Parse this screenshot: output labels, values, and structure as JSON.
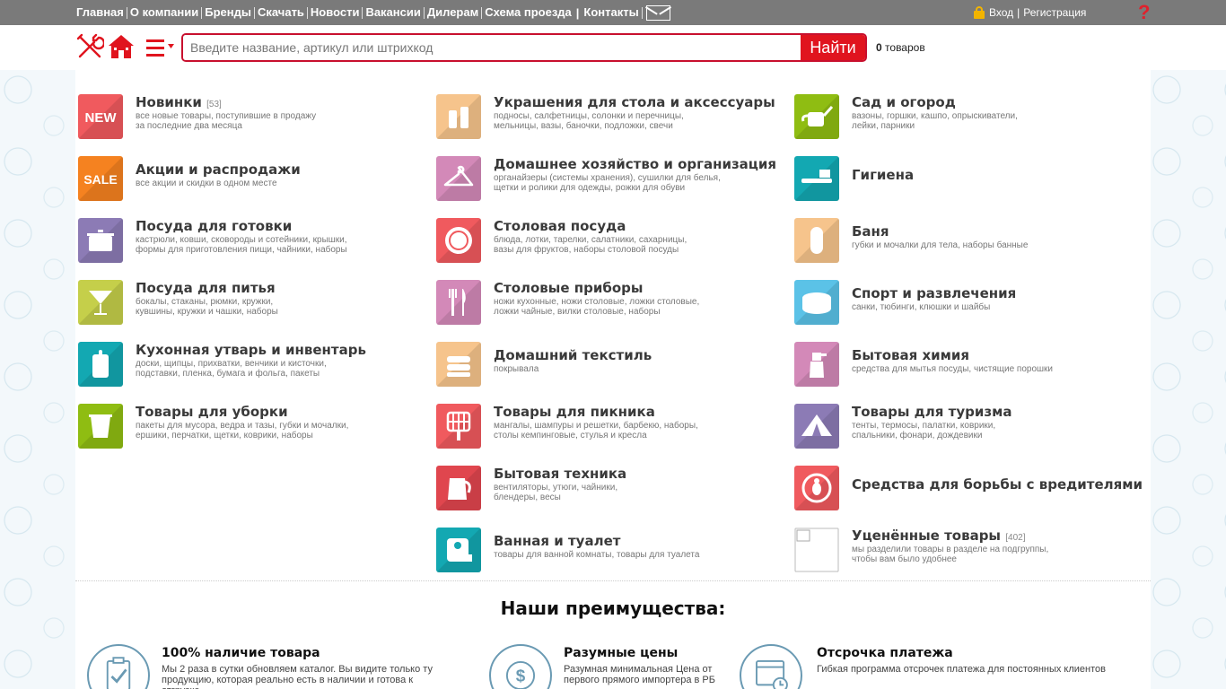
{
  "topnav": {
    "items": [
      "Главная",
      "О компании",
      "Бренды",
      "Скачать",
      "Новости",
      "Вакансии",
      "Дилерам",
      "Схема проезда",
      "Контакты"
    ],
    "mail_icon": "mail-icon"
  },
  "auth": {
    "login": "Вход",
    "separator": "|",
    "register": "Регистрация"
  },
  "help": {
    "label": "?"
  },
  "search": {
    "placeholder": "Введите название, артикул или штрихкод",
    "value": "",
    "button": "Найти"
  },
  "cart": {
    "count": "0",
    "label": "товаров"
  },
  "colors": {
    "accent": "#e0141e",
    "topbar": "#7a7a7a"
  },
  "categories": [
    {
      "title": "Новинки",
      "count": "[53]",
      "sub1": "все новые товары, поступившие в продажу",
      "sub2": "за последние два месяца",
      "icon": "new-badge-icon",
      "color": "#f05a5e"
    },
    {
      "title": "Акции и распродажи",
      "count": "",
      "sub1": "все акции и скидки в одном месте",
      "sub2": "",
      "icon": "sale-badge-icon",
      "color": "#f58220"
    },
    {
      "title": "Посуда для готовки",
      "count": "",
      "sub1": "кастрюли, ковши, сковороды и сотейники, крышки,",
      "sub2": "формы для приготовления пищи, чайники, наборы",
      "icon": "pot-icon",
      "color": "#8c7bb5"
    },
    {
      "title": "Посуда для питья",
      "count": "",
      "sub1": "бокалы, стаканы, рюмки, кружки,",
      "sub2": "кувшины, кружки и чашки, наборы",
      "icon": "cocktail-glass-icon",
      "color": "#c5cf4a"
    },
    {
      "title": "Кухонная утварь и инвентарь",
      "count": "",
      "sub1": "доски, щипцы, прихватки, венчики и кисточки,",
      "sub2": "подставки, пленка, бумага и фольга, пакеты",
      "icon": "cutting-board-icon",
      "color": "#13a8b2"
    },
    {
      "title": "Товары для уборки",
      "count": "",
      "sub1": "пакеты для мусора, ведра и тазы, губки и мочалки,",
      "sub2": "ершики, перчатки, щетки, коврики, наборы",
      "icon": "bucket-icon",
      "color": "#8fbd12"
    },
    {
      "title": "Украшения для стола и аксессуары",
      "count": "",
      "sub1": "подносы, салфетницы, солонки и перечницы,",
      "sub2": "мельницы, вазы, баночки, подложки, свечи",
      "icon": "salt-pepper-icon",
      "color": "#f6c48c"
    },
    {
      "title": "Домашнее хозяйство и организация",
      "count": "",
      "sub1": "органайзеры (системы хранения), сушилки для белья,",
      "sub2": "щетки и ролики для одежды, рожки для обуви",
      "icon": "hanger-icon",
      "color": "#d389b8"
    },
    {
      "title": "Столовая посуда",
      "count": "",
      "sub1": "блюда, лотки, тарелки, салатники, сахарницы,",
      "sub2": "вазы для фруктов, наборы столовой посуды",
      "icon": "plate-icon",
      "color": "#f05a5e"
    },
    {
      "title": "Столовые приборы",
      "count": "",
      "sub1": "ножи кухонные, ножи столовые, ложки столовые,",
      "sub2": "ложки чайные, вилки столовые, наборы",
      "icon": "cutlery-icon",
      "color": "#d389b8"
    },
    {
      "title": "Домашний текстиль",
      "count": "",
      "sub1": "покрывала",
      "sub2": "",
      "icon": "towels-icon",
      "color": "#f6c48c"
    },
    {
      "title": "Товары для пикника",
      "count": "",
      "sub1": "мангалы, шампуры и решетки, барбекю, наборы,",
      "sub2": "столы кемпинговые, стулья и кресла",
      "icon": "grill-grate-icon",
      "color": "#f05a5e"
    },
    {
      "title": "Бытовая техника",
      "count": "",
      "sub1": "вентиляторы, утюги, чайники,",
      "sub2": "блендеры, весы",
      "icon": "kettle-icon",
      "color": "#e0464e"
    },
    {
      "title": "Ванная и туалет",
      "count": "",
      "sub1": "товары для ванной комнаты, товары для туалета",
      "sub2": "",
      "icon": "toilet-paper-icon",
      "color": "#13a8b2"
    },
    {
      "title": "Сад и огород",
      "count": "",
      "sub1": "вазоны, горшки, кашпо, опрыскиватели,",
      "sub2": "лейки, парники",
      "icon": "watering-can-icon",
      "color": "#8fbd12"
    },
    {
      "title": "Гигиена",
      "count": "",
      "sub1": "",
      "sub2": "",
      "icon": "toothbrush-icon",
      "color": "#13a8b2"
    },
    {
      "title": "Баня",
      "count": "",
      "sub1": "губки и мочалки для тела, наборы банные",
      "sub2": "",
      "icon": "bath-mitt-icon",
      "color": "#f6c48c"
    },
    {
      "title": "Спорт и развлечения",
      "count": "",
      "sub1": "санки, тюбинги, клюшки и шайбы",
      "sub2": "",
      "icon": "sled-icon",
      "color": "#5bc2e7"
    },
    {
      "title": "Бытовая химия",
      "count": "",
      "sub1": "средства для мытья посуды, чистящие порошки",
      "sub2": "",
      "icon": "spray-bottle-icon",
      "color": "#d389b8"
    },
    {
      "title": "Товары для туризма",
      "count": "",
      "sub1": "тенты, термосы, палатки, коврики,",
      "sub2": "спальники, фонари, дождевики",
      "icon": "tent-icon",
      "color": "#8c7bb5"
    },
    {
      "title": "Средства для борьбы с вредителями",
      "count": "",
      "sub1": "",
      "sub2": "",
      "icon": "no-bug-icon",
      "color": "#f05a5e"
    },
    {
      "title": "Уценённые товары",
      "count": "[402]",
      "sub1": "мы разделили товары в разделе на подгруппы,",
      "sub2": "чтобы вам было удобнее",
      "icon": "broken-image-icon",
      "color": "#ffffff"
    }
  ],
  "advantages": {
    "title": "Наши преимущества:",
    "items": [
      {
        "title": "100% наличие товара",
        "text1": "Мы 2 раза в сутки обновляем каталог. Вы видите только ту",
        "text2": "продукцию, которая реально есть в наличии и готова к отгрузке",
        "icon": "clipboard-check-icon"
      },
      {
        "title": "Разумные цены",
        "text1": "Разумная минимальная Цена от",
        "text2": "первого прямого импортера в РБ",
        "icon": "dollar-refresh-icon"
      },
      {
        "title": "Отсрочка платежа",
        "text1": "Гибкая программа отсрочек платежа для постоянных клиентов",
        "text2": "",
        "icon": "calendar-clock-icon"
      }
    ]
  }
}
